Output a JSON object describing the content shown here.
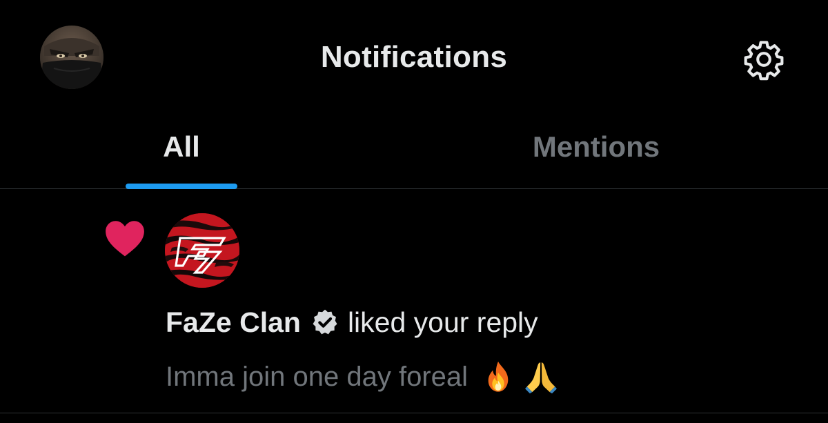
{
  "header": {
    "title": "Notifications",
    "avatar_icon": "user-avatar",
    "settings_icon": "gear-icon"
  },
  "tabs": [
    {
      "label": "All",
      "active": true
    },
    {
      "label": "Mentions",
      "active": false
    }
  ],
  "colors": {
    "accent": "#1d9bf0",
    "like": "#f91880",
    "background": "#000000",
    "text_primary": "#e7e9ea",
    "text_secondary": "#71767b"
  },
  "notifications": [
    {
      "type_icon": "heart-icon",
      "actor_name": "FaZe Clan",
      "verified": true,
      "action": "liked your reply",
      "reply_text": "Imma join one day foreal",
      "reply_emojis": [
        "fire-emoji",
        "folded-hands-emoji"
      ]
    }
  ]
}
